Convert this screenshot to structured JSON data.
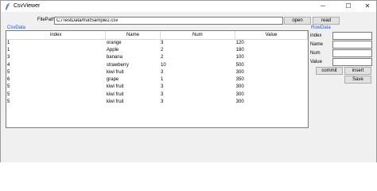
{
  "window": {
    "title": "CsvViewer",
    "controls": {
      "minimize": "─",
      "maximize": "☐",
      "close": "✕"
    }
  },
  "filepath": {
    "label": "FilePath",
    "value": "C:/TestData/fruitSample2.csv",
    "open_label": "open",
    "read_label": "read"
  },
  "csv_section": {
    "label": "CsvData"
  },
  "table": {
    "columns": [
      "index",
      "Name",
      "Num",
      "Value"
    ],
    "rows": [
      [
        "1",
        "orange",
        "3",
        "120"
      ],
      [
        "1",
        "Apple",
        "2",
        "180"
      ],
      [
        "3",
        "banana",
        "2",
        "100"
      ],
      [
        "4",
        "strawberry",
        "10",
        "500"
      ],
      [
        "5",
        "kiwi fruit",
        "3",
        "300"
      ],
      [
        "6",
        "grape",
        "1",
        "350"
      ],
      [
        "5",
        "kiwi fruit",
        "3",
        "300"
      ],
      [
        "5",
        "kiwi fruit",
        "3",
        "300"
      ],
      [
        "5",
        "kiwi fruit",
        "3",
        "300"
      ]
    ]
  },
  "row_panel": {
    "label": "RowData",
    "fields": [
      {
        "label": "index",
        "value": ""
      },
      {
        "label": "Name",
        "value": ""
      },
      {
        "label": "Num",
        "value": ""
      },
      {
        "label": "Value",
        "value": ""
      }
    ],
    "commit_label": "commit",
    "insert_label": "insert",
    "save_label": "Save"
  }
}
